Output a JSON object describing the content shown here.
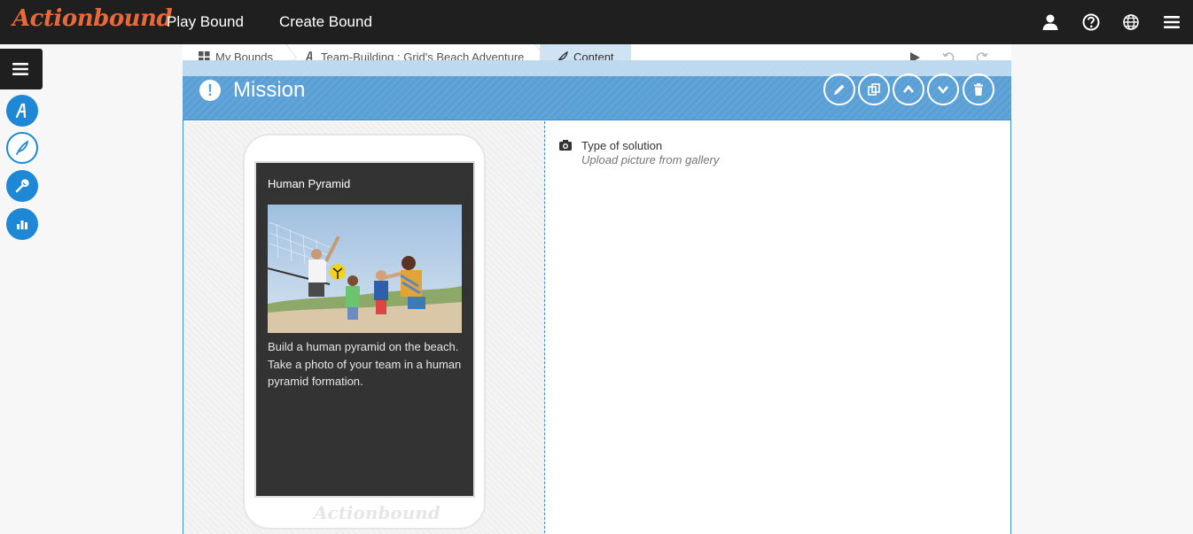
{
  "brand": {
    "logo": "Actionbound"
  },
  "nav": {
    "play": "Play Bound",
    "create": "Create Bound"
  },
  "top_icons": [
    "user-icon",
    "help-icon",
    "globe-icon",
    "menu-icon"
  ],
  "sidebar": {
    "items": [
      "menu-icon",
      "bound-icon",
      "content-feather-icon",
      "wrench-icon",
      "stats-icon"
    ]
  },
  "breadcrumb": {
    "items": [
      {
        "label": "My Bounds",
        "icon": "grid-icon"
      },
      {
        "label": "Team-Building : Grid's Beach Adventure",
        "icon": "bound-icon"
      },
      {
        "label": "Content",
        "icon": "feather-icon"
      }
    ],
    "tools": [
      "play-icon",
      "undo-icon",
      "redo-icon"
    ]
  },
  "mission": {
    "title": "Mission",
    "actions": [
      "edit-icon",
      "duplicate-icon",
      "move-up-icon",
      "move-down-icon",
      "delete-icon"
    ]
  },
  "preview": {
    "title": "Human Pyramid",
    "text": "Build a human pyramid on the beach. Take a photo of your team in a human pyramid formation.",
    "brand": "Actionbound"
  },
  "solution": {
    "label": "Type of solution",
    "value": "Upload picture from gallery"
  },
  "colors": {
    "accent": "#1e88d6",
    "mission_bar": "#5aa0d6",
    "logo": "#e8693a",
    "topbar": "#1f1f1f"
  }
}
